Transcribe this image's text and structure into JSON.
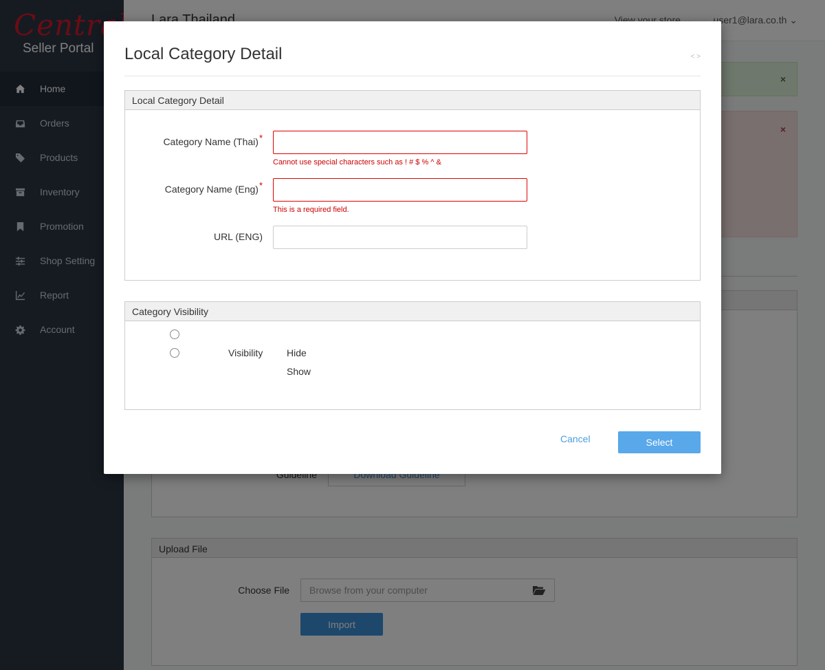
{
  "brand": {
    "logo_script": "Central",
    "logo_sub": "Seller Portal"
  },
  "sidebar": {
    "items": [
      {
        "label": "Home",
        "icon": "home-icon",
        "active": true
      },
      {
        "label": "Orders",
        "icon": "inbox-icon"
      },
      {
        "label": "Products",
        "icon": "tag-icon"
      },
      {
        "label": "Inventory",
        "icon": "archive-icon"
      },
      {
        "label": "Promotion",
        "icon": "bookmark-icon"
      },
      {
        "label": "Shop Setting",
        "icon": "sliders-icon"
      },
      {
        "label": "Report",
        "icon": "chart-line-icon"
      },
      {
        "label": "Account",
        "icon": "gear-icon"
      }
    ]
  },
  "topbar": {
    "title": "Lara Thailand",
    "view_store": "View your store ⌄",
    "user": "user1@lara.co.th ⌄"
  },
  "background": {
    "alert_close": "×",
    "guideline_label": "Guideline",
    "guideline_button": "Download Guideline",
    "upload_panel_title": "Upload File",
    "choose_file_label": "Choose File",
    "choose_file_placeholder": "Browse from your computer",
    "import_button": "Import"
  },
  "modal": {
    "title": "Local Category Detail",
    "close": "˂ ˃",
    "detail_panel": {
      "title": "Local Category Detail",
      "fields": [
        {
          "label": "Category Name (Thai)",
          "required": "*",
          "value": "",
          "error": "Cannot use special characters such as ! # $ % ^ &"
        },
        {
          "label": "Category Name (Eng)",
          "required": "*",
          "value": "",
          "error": "This is a required field."
        },
        {
          "label": "URL (ENG)",
          "value": ""
        }
      ]
    },
    "visibility_panel": {
      "title": "Category Visibility",
      "label": "Visibility",
      "options": [
        "Hide",
        "Show"
      ]
    },
    "cancel": "Cancel",
    "select": "Select"
  }
}
